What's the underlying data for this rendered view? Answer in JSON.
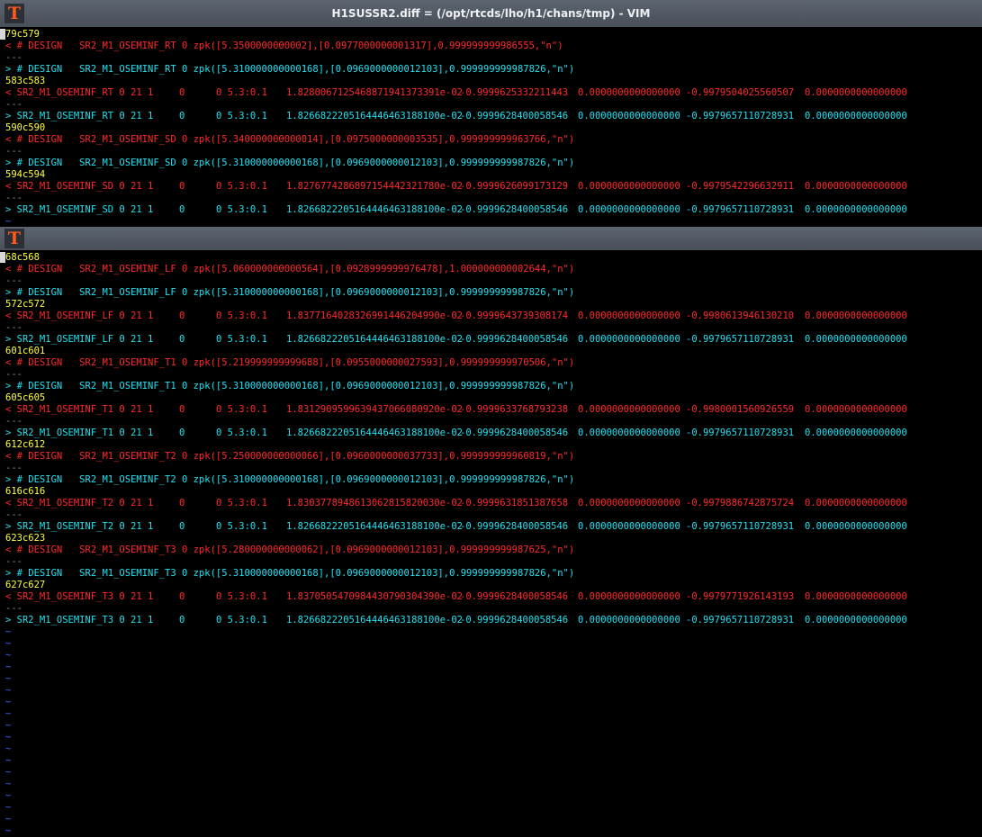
{
  "window": {
    "title": "H1SUSSR2.diff = (/opt/rtcds/lho/h1/chans/tmp) - VIM",
    "icon": "vim-app-icon"
  },
  "pane1": {
    "lines": [
      {
        "t": "hunk",
        "text": "579c579",
        "cursor": true
      },
      {
        "t": "del",
        "text": "< # DESIGN   SR2_M1_OSEMINF_RT 0 zpk([5.3500000000002],[0.0977000000001317],0.999999999986555,\"n\")"
      },
      {
        "t": "sep",
        "text": "---"
      },
      {
        "t": "add",
        "text": "> # DESIGN   SR2_M1_OSEMINF_RT 0 zpk([5.310000000000168],[0.0969000000012103],0.999999999987826,\"n\")"
      },
      {
        "t": "hunk",
        "text": "583c583"
      },
      {
        "t": "del",
        "cols": [
          "< SR2_M1_OSEMINF_RT 0 21 1",
          "0",
          "0 5.3:0.1",
          "1.8280067125468871941373391e-02",
          "-0.9999625332211443",
          "0.0000000000000000",
          "-0.9979504025560507",
          "0.0000000000000000"
        ]
      },
      {
        "t": "sep",
        "text": "---"
      },
      {
        "t": "add",
        "cols": [
          "> SR2_M1_OSEMINF_RT 0 21 1",
          "0",
          "0 5.3:0.1",
          "1.8266822205164446463188100e-02",
          "-0.9999628400058546",
          "0.0000000000000000",
          "-0.9979657110728931",
          "0.0000000000000000"
        ]
      },
      {
        "t": "hunk",
        "text": "590c590"
      },
      {
        "t": "del",
        "text": "< # DESIGN   SR2_M1_OSEMINF_SD 0 zpk([5.340000000000014],[0.0975000000003535],0.999999999963766,\"n\")"
      },
      {
        "t": "sep",
        "text": "---"
      },
      {
        "t": "add",
        "text": "> # DESIGN   SR2_M1_OSEMINF_SD 0 zpk([5.310000000000168],[0.0969000000012103],0.999999999987826,\"n\")"
      },
      {
        "t": "hunk",
        "text": "594c594"
      },
      {
        "t": "del",
        "cols": [
          "< SR2_M1_OSEMINF_SD 0 21 1",
          "0",
          "0 5.3:0.1",
          "1.8276774286897154442321780e-02",
          "-0.9999626099173129",
          "0.0000000000000000",
          "-0.9979542296632911",
          "0.0000000000000000"
        ]
      },
      {
        "t": "sep",
        "text": "---"
      },
      {
        "t": "add",
        "cols": [
          "> SR2_M1_OSEMINF_SD 0 21 1",
          "0",
          "0 5.3:0.1",
          "1.8266822205164446463188100e-02",
          "-0.9999628400058546",
          "0.0000000000000000",
          "-0.9979657110728931",
          "0.0000000000000000"
        ]
      },
      {
        "t": "tilde",
        "text": "~"
      }
    ]
  },
  "pane2": {
    "lines": [
      {
        "t": "hunk",
        "text": "568c568",
        "cursor": true
      },
      {
        "t": "del",
        "text": "< # DESIGN   SR2_M1_OSEMINF_LF 0 zpk([5.060000000000564],[0.0928999999976478],1.000000000002644,\"n\")"
      },
      {
        "t": "sep",
        "text": "---"
      },
      {
        "t": "add",
        "text": "> # DESIGN   SR2_M1_OSEMINF_LF 0 zpk([5.310000000000168],[0.0969000000012103],0.999999999987826,\"n\")"
      },
      {
        "t": "hunk",
        "text": "572c572"
      },
      {
        "t": "del",
        "cols": [
          "< SR2_M1_OSEMINF_LF 0 21 1",
          "0",
          "0 5.3:0.1",
          "1.8377164028326991446204990e-02",
          "-0.9999643739308174",
          "0.0000000000000000",
          "-0.9980613946130210",
          "0.0000000000000000"
        ]
      },
      {
        "t": "sep",
        "text": "---"
      },
      {
        "t": "add",
        "cols": [
          "> SR2_M1_OSEMINF_LF 0 21 1",
          "0",
          "0 5.3:0.1",
          "1.8266822205164446463188100e-02",
          "-0.9999628400058546",
          "0.0000000000000000",
          "-0.9979657110728931",
          "0.0000000000000000"
        ]
      },
      {
        "t": "hunk",
        "text": "601c601"
      },
      {
        "t": "del",
        "text": "< # DESIGN   SR2_M1_OSEMINF_T1 0 zpk([5.219999999999688],[0.0955000000027593],0.999999999970506,\"n\")"
      },
      {
        "t": "sep",
        "text": "---"
      },
      {
        "t": "add",
        "text": "> # DESIGN   SR2_M1_OSEMINF_T1 0 zpk([5.310000000000168],[0.0969000000012103],0.999999999987826,\"n\")"
      },
      {
        "t": "hunk",
        "text": "605c605"
      },
      {
        "t": "del",
        "cols": [
          "< SR2_M1_OSEMINF_T1 0 21 1",
          "0",
          "0 5.3:0.1",
          "1.8312909599639437066080920e-02",
          "-0.9999633768793238",
          "0.0000000000000000",
          "-0.9980001560926559",
          "0.0000000000000000"
        ]
      },
      {
        "t": "sep",
        "text": "---"
      },
      {
        "t": "add",
        "cols": [
          "> SR2_M1_OSEMINF_T1 0 21 1",
          "0",
          "0 5.3:0.1",
          "1.8266822205164446463188100e-02",
          "-0.9999628400058546",
          "0.0000000000000000",
          "-0.9979657110728931",
          "0.0000000000000000"
        ]
      },
      {
        "t": "hunk",
        "text": "612c612"
      },
      {
        "t": "del",
        "text": "< # DESIGN   SR2_M1_OSEMINF_T2 0 zpk([5.250000000000066],[0.0960000000037733],0.999999999960819,\"n\")"
      },
      {
        "t": "sep",
        "text": "---"
      },
      {
        "t": "add",
        "text": "> # DESIGN   SR2_M1_OSEMINF_T2 0 zpk([5.310000000000168],[0.0969000000012103],0.999999999987826,\"n\")"
      },
      {
        "t": "hunk",
        "text": "616c616"
      },
      {
        "t": "del",
        "cols": [
          "< SR2_M1_OSEMINF_T2 0 21 1",
          "0",
          "0 5.3:0.1",
          "1.8303778948613062815820030e-02",
          "-0.9999631851387658",
          "0.0000000000000000",
          "-0.9979886742875724",
          "0.0000000000000000"
        ]
      },
      {
        "t": "sep",
        "text": "---"
      },
      {
        "t": "add",
        "cols": [
          "> SR2_M1_OSEMINF_T2 0 21 1",
          "0",
          "0 5.3:0.1",
          "1.8266822205164446463188100e-02",
          "-0.9999628400058546",
          "0.0000000000000000",
          "-0.9979657110728931",
          "0.0000000000000000"
        ]
      },
      {
        "t": "hunk",
        "text": "623c623"
      },
      {
        "t": "del",
        "text": "< # DESIGN   SR2_M1_OSEMINF_T3 0 zpk([5.280000000000062],[0.0969000000012103],0.999999999987625,\"n\")"
      },
      {
        "t": "sep",
        "text": "---"
      },
      {
        "t": "add",
        "text": "> # DESIGN   SR2_M1_OSEMINF_T3 0 zpk([5.310000000000168],[0.0969000000012103],0.999999999987826,\"n\")"
      },
      {
        "t": "hunk",
        "text": "627c627"
      },
      {
        "t": "del",
        "cols": [
          "< SR2_M1_OSEMINF_T3 0 21 1",
          "0",
          "0 5.3:0.1",
          "1.8370505470984430790304390e-02",
          "-0.9999628400058546",
          "0.0000000000000000",
          "-0.9979771926143193",
          "0.0000000000000000"
        ]
      },
      {
        "t": "sep",
        "text": "---"
      },
      {
        "t": "add",
        "cols": [
          "> SR2_M1_OSEMINF_T3 0 21 1",
          "0",
          "0 5.3:0.1",
          "1.8266822205164446463188100e-02",
          "-0.9999628400058546",
          "0.0000000000000000",
          "-0.9979657110728931",
          "0.0000000000000000"
        ]
      },
      {
        "t": "tilde",
        "text": "~"
      },
      {
        "t": "tilde",
        "text": "~"
      },
      {
        "t": "tilde",
        "text": "~"
      },
      {
        "t": "tilde",
        "text": "~"
      },
      {
        "t": "tilde",
        "text": "~"
      },
      {
        "t": "tilde",
        "text": "~"
      },
      {
        "t": "tilde",
        "text": "~"
      },
      {
        "t": "tilde",
        "text": "~"
      },
      {
        "t": "tilde",
        "text": "~"
      },
      {
        "t": "tilde",
        "text": "~"
      },
      {
        "t": "tilde",
        "text": "~"
      },
      {
        "t": "tilde",
        "text": "~"
      },
      {
        "t": "tilde",
        "text": "~"
      },
      {
        "t": "tilde",
        "text": "~"
      },
      {
        "t": "tilde",
        "text": "~"
      },
      {
        "t": "tilde",
        "text": "~"
      },
      {
        "t": "tilde",
        "text": "~"
      },
      {
        "t": "tilde",
        "text": "~"
      }
    ]
  }
}
